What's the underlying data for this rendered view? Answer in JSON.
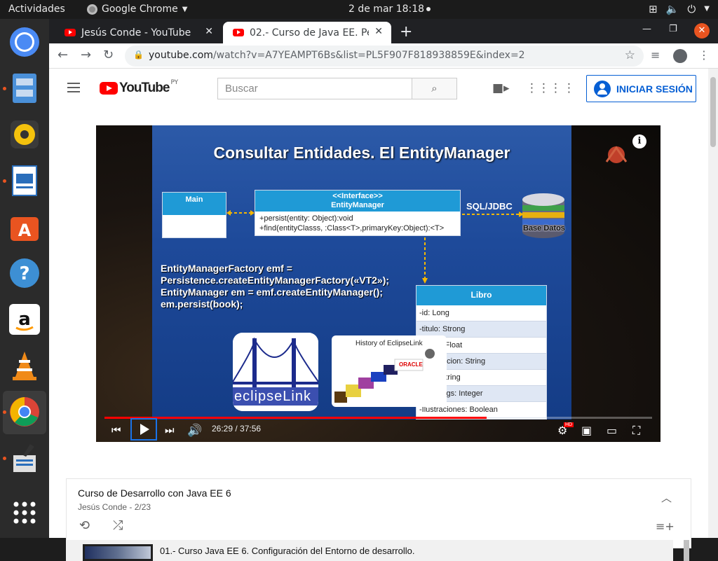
{
  "system": {
    "activities": "Actividades",
    "app_name": "Google Chrome",
    "clock": "2 de mar  18:18"
  },
  "dock": {
    "items": [
      "chrome",
      "files",
      "rhythmbox",
      "libreoffice-writer",
      "software",
      "help",
      "amazon",
      "vlc",
      "chrome-active",
      "inkscape",
      "show-apps"
    ]
  },
  "browser": {
    "tabs": [
      {
        "title": "Jesús Conde - YouTube"
      },
      {
        "title": "02.- Curso de Java EE. Per"
      }
    ],
    "url_host": "youtube.com",
    "url_path": "/watch?v=A7YEAMPT6Bs&list=PL5F907F818938859E&index=2"
  },
  "youtube": {
    "logo_text": "YouTube",
    "country": "PY",
    "search_placeholder": "Buscar",
    "signin_label": "INICIAR SESIÓN"
  },
  "video": {
    "slide_title": "Consultar Entidades. El EntityManager",
    "main_box": "Main",
    "interface_stereotype": "<<Interface>>",
    "interface_name": "EntityManager",
    "interface_methods": [
      "+persist(entity: Object):void",
      "+find(entityClasss, :Class<T>,primaryKey:Object):<T>"
    ],
    "sql_label": "SQL/JDBC",
    "db_label": "Base Datos",
    "code_lines": [
      "EntityManagerFactory emf =",
      "Persistence.createEntityManagerFactory(«VT2»);",
      "EntityManager em = emf.createEntityManager();",
      "em.persist(book);"
    ],
    "libro_title": "Libro",
    "libro_fields": [
      "-id: Long",
      "-titulo: Strong",
      "-precio:Float",
      "-descripcion: String",
      "-isbn: String",
      "-numPags: Integer",
      "-Ilustraciones: Boolean"
    ],
    "eclipse_logo_text": "eclipseLink",
    "history_title": "History of EclipseLink",
    "history_oracle": "ORACLE",
    "current_time": "26:29",
    "duration": "37:56",
    "time_display": "26:29 / 37:56",
    "progress": 0.698,
    "hd_badge": "HD"
  },
  "playlist": {
    "title": "Curso de Desarrollo con Java EE 6",
    "subtitle": "Jesús Conde - 2/23",
    "first_item": "01.- Curso Java EE 6. Configuración del Entorno de desarrollo."
  },
  "colors": {
    "yt_red": "#ff0000",
    "yt_blue": "#065fd4",
    "ubuntu_orange": "#e95420",
    "uml_header": "#1f9ad6"
  }
}
